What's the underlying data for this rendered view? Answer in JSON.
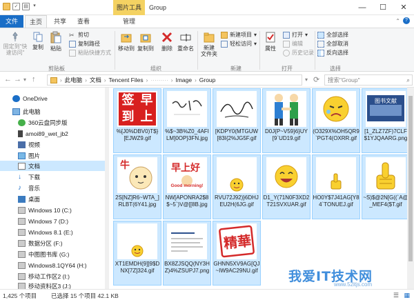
{
  "titlebar": {
    "context_tab": "图片工具",
    "title": "Group",
    "minimize": "—",
    "maximize": "☐",
    "close": "✕"
  },
  "tabs": [
    "文件",
    "主页",
    "共享",
    "查看",
    "管理"
  ],
  "ribbon": {
    "pin": "固定到\"快\n速访问\"",
    "copy": "复制",
    "paste": "粘贴",
    "cut": "剪切",
    "copy_path": "复制路径",
    "paste_shortcut": "粘贴快捷方式",
    "clipboard_group": "剪贴板",
    "move_to": "移动到",
    "copy_to": "复制到",
    "delete": "删除",
    "rename": "重命名",
    "organize_group": "组织",
    "new_folder": "新建\n文件夹",
    "new_item": "新建项目",
    "easy_access": "轻松访问",
    "new_group": "新建",
    "properties": "属性",
    "open": "打开",
    "edit": "编辑",
    "history": "历史记录",
    "open_group": "打开",
    "select_all": "全部选择",
    "select_none": "全部取消",
    "invert": "反向选择",
    "select_group": "选择"
  },
  "address": {
    "path": [
      "此电脑",
      "文档",
      "Tencent Files",
      "·········",
      "Image",
      "Group"
    ],
    "search_placeholder": "搜索\"Group\""
  },
  "nav": [
    {
      "label": "OneDrive",
      "icon": "cloud-icon"
    },
    {
      "label": "此电脑",
      "icon": "computer-icon"
    },
    {
      "label": "360云盘同步版",
      "icon": "cloud-drive-icon"
    },
    {
      "label": "amoi89_wet_jb2",
      "icon": "phone-icon"
    },
    {
      "label": "视频",
      "icon": "video-icon"
    },
    {
      "label": "图片",
      "icon": "picture-icon"
    },
    {
      "label": "文档",
      "icon": "document-icon",
      "selected": true
    },
    {
      "label": "下载",
      "icon": "download-icon"
    },
    {
      "label": "音乐",
      "icon": "music-icon"
    },
    {
      "label": "桌面",
      "icon": "desktop-icon"
    },
    {
      "label": "Windows 10 (C:)",
      "icon": "drive-icon"
    },
    {
      "label": "Windows 7 (D:)",
      "icon": "drive-icon"
    },
    {
      "label": "Windows 8.1 (E:)",
      "icon": "drive-icon"
    },
    {
      "label": "数据分区 (F:)",
      "icon": "drive-icon"
    },
    {
      "label": "中图图书库 (G:)",
      "icon": "drive-icon"
    },
    {
      "label": "Windows8.1QY64 (H:)",
      "icon": "drive-icon"
    },
    {
      "label": "移动工作区2 (I:)",
      "icon": "drive-icon"
    },
    {
      "label": "移动资料区3 (J:)",
      "icon": "drive-icon"
    }
  ],
  "files": [
    {
      "name": "%[J0%DBV0)T$}[EJWZ9.gif",
      "thumb": "qiandao"
    },
    {
      "name": "%$~3B%Z0_4AFILM]0OP}3FN.jpg",
      "thumb": "handwriting"
    },
    {
      "name": "[KDPY0(MTGUW[83I{2%JG5F.gif",
      "thumb": "signature"
    },
    {
      "name": "D0J{P~V59}6}UY[9`UD19.gif",
      "thumb": "handshake"
    },
    {
      "name": "(O329X%OH5QR9`PGT4(OXRR.gif",
      "thumb": "cryface"
    },
    {
      "name": "[1_ZLZ7ZF)7CLF$1YJQAARG.png",
      "thumb": "bookbanner"
    },
    {
      "name": "2S[NZ]R6~WTA_]RLBT(6Y41.jpg",
      "thumb": "cow"
    },
    {
      "name": "NW[APONRA2$8$~5`)V@[[8B.jpg",
      "thumb": "goodmorning"
    },
    {
      "name": "RVU72J92)}6DHJEU2H(6JG.gif",
      "thumb": "smallface"
    },
    {
      "name": "D1_Y(71N0F3XD2T21SVXUAR.gif",
      "thumb": "laughface"
    },
    {
      "name": "HO0Y$7J41AG[Y84`TONUEJ.gif",
      "thumb": "thumbsup"
    },
    {
      "name": "~S)$@2N[G((`A@_MEF4($T.gif",
      "thumb": "thumbsup2"
    },
    {
      "name": "XT1EMDH(9]]9$DNX[7Z]324.gif",
      "thumb": "smallface2"
    },
    {
      "name": "BX8ZJSQQ(NY3HZ)4%ZSUPJ7.png",
      "thumb": "textdoc"
    },
    {
      "name": "GHNN5XV9AG[QJ~IW9AC29NU.gif",
      "thumb": "stamp"
    }
  ],
  "thumb_text": {
    "qiandao": [
      "签",
      "到",
      "早",
      "上"
    ],
    "goodmorning": "Good morning!",
    "bookbanner": "图书文献"
  },
  "status": {
    "count": "1,425 个项目",
    "selected": "已选择 15 个项目  42.1 KB"
  },
  "watermark": {
    "text": "我爱IT技术网",
    "url": "www.52itjs.com"
  },
  "colors": {
    "accent": "#1a6ec7",
    "selection": "#cce8ff",
    "selection_border": "#99d1ff",
    "context_tab": "#f4d262"
  }
}
